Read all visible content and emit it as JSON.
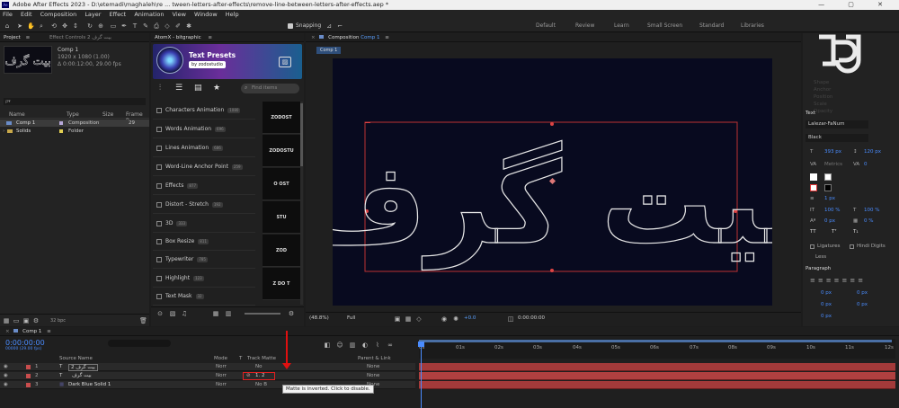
{
  "window": {
    "app_badge": "Ae",
    "title": "Adobe After Effects 2023 - D:\\etemadi\\maghaleh\\re ... tween-letters-after-effects\\remove-line-between-letters-after-effects.aep *",
    "controls": "—  ▢  ✕"
  },
  "menu": [
    "File",
    "Edit",
    "Composition",
    "Layer",
    "Effect",
    "Animation",
    "View",
    "Window",
    "Help"
  ],
  "toolbar": {
    "snapping": "Snapping",
    "workspaces": [
      "Default",
      "Review",
      "Learn",
      "Small Screen",
      "Standard",
      "Libraries"
    ],
    "search_icon": "search-icon"
  },
  "project": {
    "tab": "Project",
    "tab_menu": "≡",
    "effect_controls_tab": "Effect Controls 2 بیت گرف",
    "comp_name": "Comp 1",
    "comp_info1": "1920 x 1080 (1.00)",
    "comp_info2": "Δ 0:00:12:00, 29.00 fps",
    "search_placeholder": "ρ▾",
    "columns": [
      "Name",
      "Type",
      "Size",
      "Frame R..."
    ],
    "items": [
      {
        "name": "Comp 1",
        "type": "Composition",
        "size": "",
        "fr": "29",
        "color": "#b7a8d9"
      },
      {
        "name": "Solids",
        "type": "Folder",
        "size": "",
        "fr": "",
        "color": "#e2cf53"
      }
    ],
    "bpc": "32 bpc"
  },
  "atomx": {
    "tab": "AtomX - bitgraphic",
    "header_title": "Text Presets",
    "header_by": "by zodostudio",
    "search_placeholder": "Find items",
    "items": [
      {
        "label": "Characters Animation",
        "count": "1080"
      },
      {
        "label": "Words Animation",
        "count": "696"
      },
      {
        "label": "Lines Animation",
        "count": "686"
      },
      {
        "label": "Word-Line Anchor Point",
        "count": "259"
      },
      {
        "label": "Effects",
        "count": "877"
      },
      {
        "label": "Distort - Stretch",
        "count": "192"
      },
      {
        "label": "3D",
        "count": "333"
      },
      {
        "label": "Box Resize",
        "count": "811"
      },
      {
        "label": "Typewriter",
        "count": "785"
      },
      {
        "label": "Highlight",
        "count": "123"
      },
      {
        "label": "Text Mask",
        "count": "32"
      }
    ],
    "thumbs": [
      "ZODOST",
      "ZODOSTU",
      "O  OST",
      "STU",
      "ZOD",
      "Z DO T"
    ]
  },
  "composition": {
    "tab": "Composition Comp 1",
    "tab_prefix": "Composition",
    "tab_comp": "Comp 1",
    "subtab": "Comp 1",
    "text": "بیت گرف",
    "zoom": "(48.8%)",
    "quality": "Full",
    "exposure": "+0.0",
    "timecode": "0:00:00:00"
  },
  "right_panel": {
    "section_text": "Text",
    "font": "Lalezar-FaNum",
    "style": "Black",
    "size": "393 px",
    "leading": "120 px",
    "tracking": "Metrics",
    "kerning": "0",
    "stroke": "1 px",
    "scale_v": "100 %",
    "scale_h": "100 %",
    "baseline": "0 px",
    "tsume": "0 %",
    "tt_buttons": [
      "TT",
      "Tᵀ",
      "T₁"
    ],
    "ligatures": "Ligatures",
    "hindi": "Hindi Digits",
    "less": "Less",
    "section_paragraph": "Paragraph",
    "indents": [
      "0 px",
      "0 px",
      "0 px",
      "0 px",
      "0 px"
    ],
    "faded": [
      "Shape",
      "Anchor",
      "Position",
      "Scale",
      "Opacity"
    ]
  },
  "timeline": {
    "tab": "Comp 1",
    "timecode": "0:00:00:00",
    "fps": "00000 (29.00 fps)",
    "columns": {
      "source": "Source Name",
      "mode": "Mode",
      "t": "T",
      "matte": "Track Matte",
      "parent": "Parent & Link"
    },
    "ruler": [
      "0s",
      "01s",
      "02s",
      "03s",
      "04s",
      "05s",
      "06s",
      "07s",
      "08s",
      "09s",
      "10s",
      "11s",
      "12s"
    ],
    "layers": [
      {
        "num": "1",
        "type": "T",
        "name": "بیت گرف 2",
        "mode": "Norr",
        "matte": "No",
        "parent": "None",
        "color": "#c94d4d"
      },
      {
        "num": "2",
        "type": "T",
        "name": "بیت گرف",
        "mode": "Norr",
        "matte": "1. 2",
        "parent": "None",
        "color": "#c94d4d"
      },
      {
        "num": "3",
        "type": "■",
        "name": "Dark Blue Solid 1",
        "mode": "Norr",
        "matte": "No B",
        "parent": "None",
        "color": "#c94d4d"
      }
    ],
    "tooltip": "Matte is inverted. Click to disable."
  }
}
